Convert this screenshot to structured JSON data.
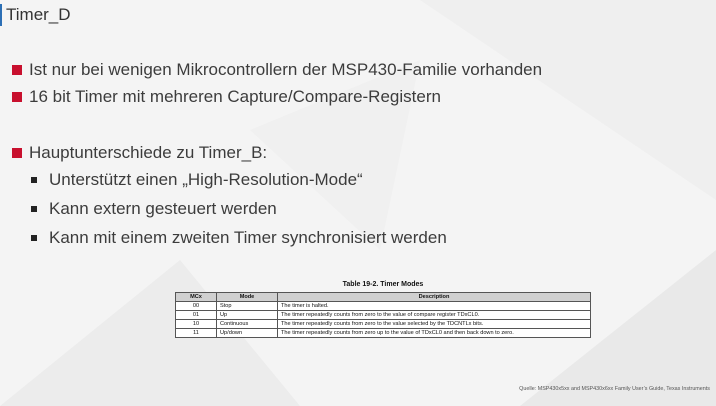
{
  "slide": {
    "title": "Timer_D",
    "bullets_top": [
      "Ist nur bei wenigen Mikrocontrollern der MSP430-Familie vorhanden",
      "16 bit Timer mit mehreren Capture/Compare-Registern"
    ],
    "bullet_main": "Hauptunterschiede zu Timer_B:",
    "sub_bullets": [
      "Unterstützt einen „High-Resolution-Mode“",
      "Kann extern gesteuert werden",
      "Kann mit einem zweiten Timer synchronisiert werden"
    ]
  },
  "table": {
    "caption": "Table 19-2. Timer Modes",
    "headers": [
      "MCx",
      "Mode",
      "Description"
    ],
    "rows": [
      [
        "00",
        "Stop",
        "The timer is halted."
      ],
      [
        "01",
        "Up",
        "The timer repeatedly counts from zero to the value of compare register TDxCL0."
      ],
      [
        "10",
        "Continuous",
        "The timer repeatedly counts from zero to the value selected by the TDCNTLx bits."
      ],
      [
        "11",
        "Up/down",
        "The timer repeatedly counts from zero up to the value of TDxCL0 and then back down to zero."
      ]
    ]
  },
  "source": "Quelle: MSP430x5xx and MSP430x6xx Family User’s Guide, Texas Instruments",
  "colors": {
    "bullet_red": "#c8102e",
    "title_accent": "#2c6fb5"
  }
}
